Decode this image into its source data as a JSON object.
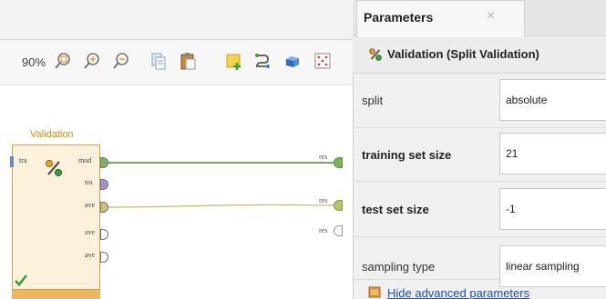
{
  "toolbar": {
    "zoom": "90%",
    "icons": [
      "zoom-fit-icon",
      "zoom-in-icon",
      "zoom-out-icon",
      "copy-icon",
      "paste-icon",
      "add-note-icon",
      "auto-wire-icon",
      "arrange-icon",
      "grid-icon"
    ]
  },
  "operator": {
    "title": "Validation",
    "ports_in": [
      "tra"
    ],
    "ports_out": [
      "mod",
      "tra",
      "ave",
      "ave",
      "ave"
    ],
    "status": "ok"
  },
  "results": {
    "ports": [
      "res",
      "res",
      "res"
    ]
  },
  "panel": {
    "tab": "Parameters",
    "operator_name": "Validation (Split Validation)",
    "params": [
      {
        "label": "split",
        "value": "absolute",
        "bold": false
      },
      {
        "label": "training set size",
        "value": "21",
        "bold": true
      },
      {
        "label": "test set size",
        "value": "-1",
        "bold": true
      },
      {
        "label": "sampling type",
        "value": "linear sampling",
        "bold": false
      }
    ],
    "advanced_link": "Hide advanced parameters"
  },
  "colors": {
    "operator_fill": "#fdf1dc",
    "operator_border": "#d7a24a",
    "operator_title": "#e08a00",
    "wire_model": "#4f8a3e",
    "wire_perf": "#c8b65a",
    "port_model": "#7ab55c",
    "port_training": "#a98fd6",
    "port_perf": "#c8c278",
    "link": "#1a4fb5"
  }
}
